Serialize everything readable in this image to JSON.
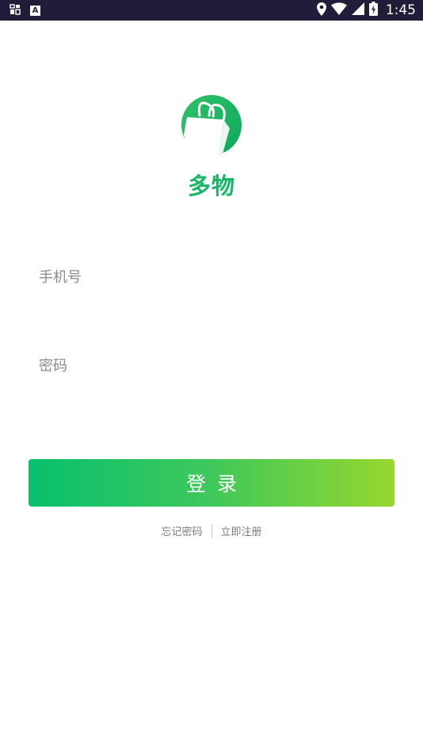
{
  "status_bar": {
    "time": "1:45",
    "icons": [
      "gallery-icon",
      "a-icon",
      "location-icon",
      "wifi-icon",
      "signal-icon",
      "battery-charging-icon"
    ],
    "a_glyph": "A"
  },
  "brand": {
    "app_name": "多物",
    "logo_icon": "shopping-bag-icon",
    "primary_color": "#16b868",
    "gradient_start": "#08c06e",
    "gradient_end": "#97d72f"
  },
  "form": {
    "phone_placeholder": "手机号",
    "phone_value": "",
    "password_placeholder": "密码",
    "password_value": ""
  },
  "actions": {
    "login_label": "登录",
    "forgot_password": "忘记密码",
    "register_now": "立即注册"
  }
}
